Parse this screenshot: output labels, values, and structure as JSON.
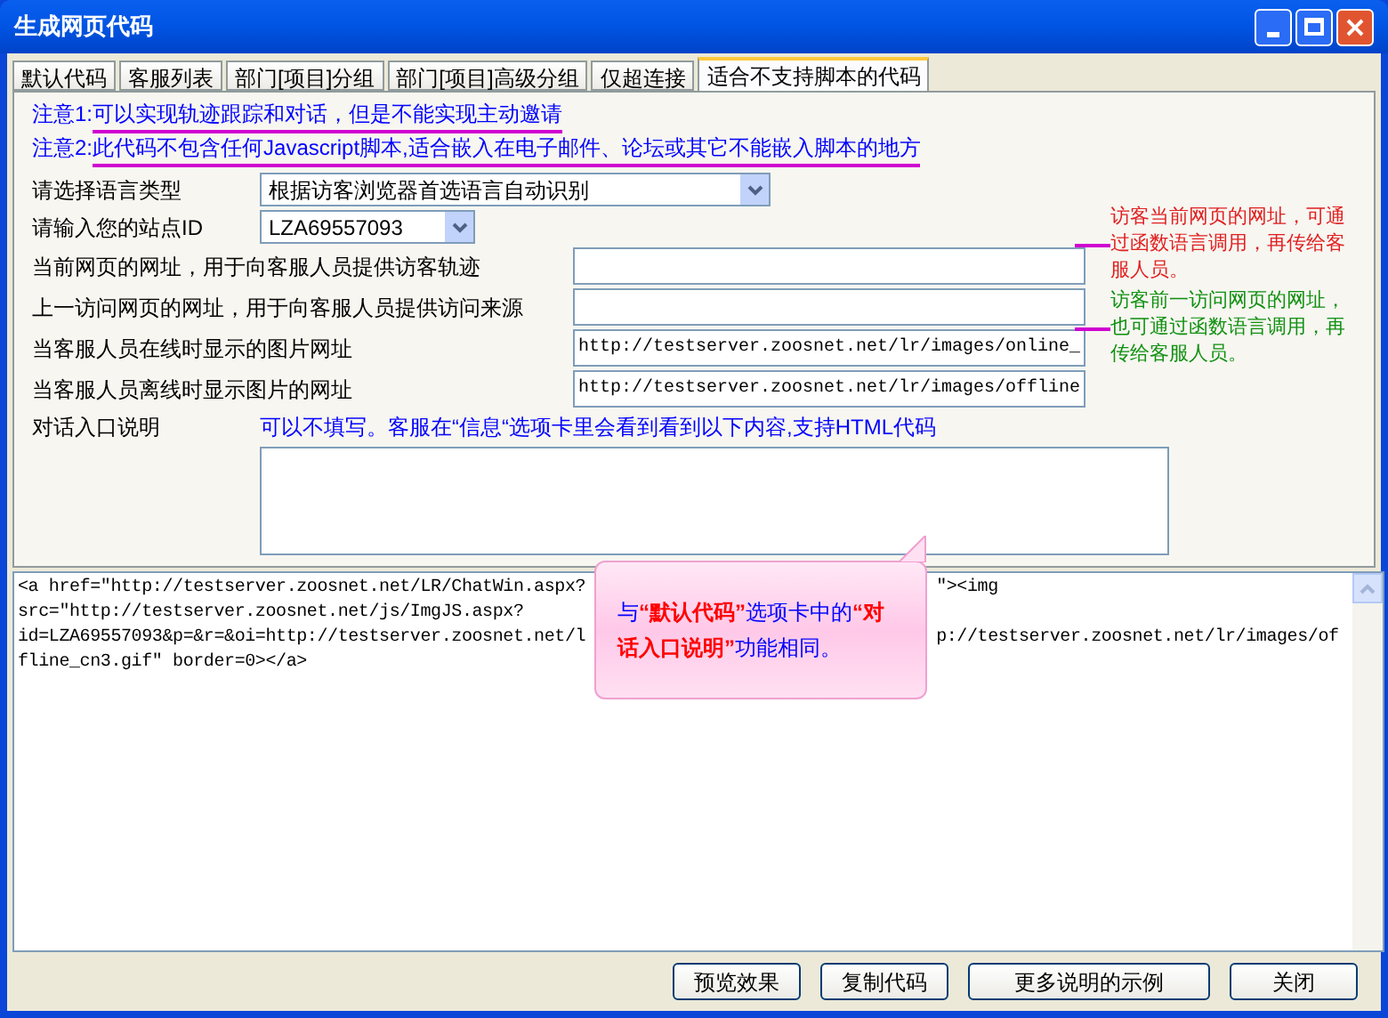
{
  "window": {
    "title": "生成网页代码"
  },
  "tabs": [
    {
      "label": "默认代码",
      "selected": false
    },
    {
      "label": "客服列表",
      "selected": false
    },
    {
      "label": "部门[项目]分组",
      "selected": false
    },
    {
      "label": "部门[项目]高级分组",
      "selected": false
    },
    {
      "label": "仅超连接",
      "selected": false
    },
    {
      "label": "适合不支持脚本的代码",
      "selected": true
    }
  ],
  "notes": [
    {
      "prefix": "注意1:",
      "text": "可以实现轨迹跟踪和对话，但是不能实现主动邀请"
    },
    {
      "prefix": "注意2:",
      "text": "此代码不包含任何Javascript脚本,适合嵌入在电子邮件、论坛或其它不能嵌入脚本的地方"
    }
  ],
  "form": [
    {
      "kind": "select",
      "label": "请选择语言类型",
      "value": "根据访客浏览器首选语言自动识别"
    },
    {
      "kind": "combo",
      "label": "请输入您的站点ID",
      "value": "LZA69557093"
    },
    {
      "kind": "input",
      "label": "当前网页的网址，用于向客服人员提供访客轨迹"
    },
    {
      "kind": "input",
      "label": "上一访问网页的网址，用于向客服人员提供访问来源"
    },
    {
      "kind": "input",
      "label": "当客服人员在线时显示的图片网址",
      "value": "http://testserver.zoosnet.net/lr/images/online_"
    },
    {
      "kind": "input",
      "label": "当客服人员离线时显示图片的网址",
      "value": "http://testserver.zoosnet.net/lr/images/offline"
    }
  ],
  "annotations": [
    {
      "text": "访客当前网页的网址，可通过函数语言调用，再传给客服人员。",
      "color": "#e02020"
    },
    {
      "text": "访客前一访问网页的网址，也可通过函数语言调用，再传给客服人员。",
      "color": "#109010"
    }
  ],
  "entry": {
    "label": "对话入口说明",
    "hint": "可以不填写。客服在“信息“选项卡里会看到看到以下内容,支持HTML代码"
  },
  "code_lines": [
    [
      "<a href=\"http://testserver.zoosnet.net/LR/ChatWin.aspx?",
      "\"><img"
    ],
    [
      "src=\"http://testserver.zoosnet.net/js/ImgJS.aspx?"
    ],
    [
      "id=LZA69557093&p=&r=&oi=http://testserver.zoosnet.net/l",
      "p://testserver.zoosnet.net/lr/images/of"
    ],
    [
      "fline_cn3.gif\" border=0></a>"
    ]
  ],
  "callout": "与**“默认代码”**选项卡中的**“对话入口说明”**功能相同。",
  "buttons": [
    "预览效果",
    "复制代码",
    "更多说明的示例",
    "关闭"
  ]
}
